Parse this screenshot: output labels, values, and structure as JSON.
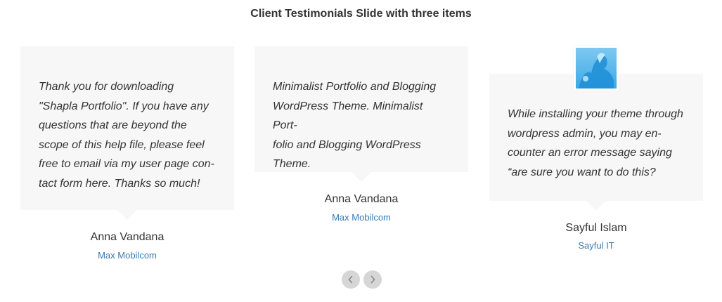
{
  "title": "Client Testimonials Slide with three items",
  "testimonials": [
    {
      "quote": "Thank you for downloading\n\"Shapla Portfolio\". If you have any\nquestions that are beyond the\nscope of this help file, please feel\nfree to email via my user page con-\ntact form here. Thanks so much!",
      "name": "Anna Vandana",
      "company": "Max Mobilcom"
    },
    {
      "quote": "Minimalist Portfolio and Blogging\nWordPress Theme. Minimalist Port-\nfolio and Blogging WordPress\nTheme.",
      "name": "Anna Vandana",
      "company": "Max Mobilcom"
    },
    {
      "quote": "While installing your theme through\nwordpress admin, you may en-\ncounter an error message saying\n“are sure you want to do this?",
      "name": "Sayful Islam",
      "company": "Sayful IT",
      "avatar": "avatar-photo"
    }
  ],
  "navigation": {
    "prev_icon": "chevron-left-icon",
    "next_icon": "chevron-right-icon"
  },
  "colors": {
    "card_bg": "#f7f7f8",
    "link": "#3a79b0",
    "nav_bg": "#d6d6d6"
  }
}
